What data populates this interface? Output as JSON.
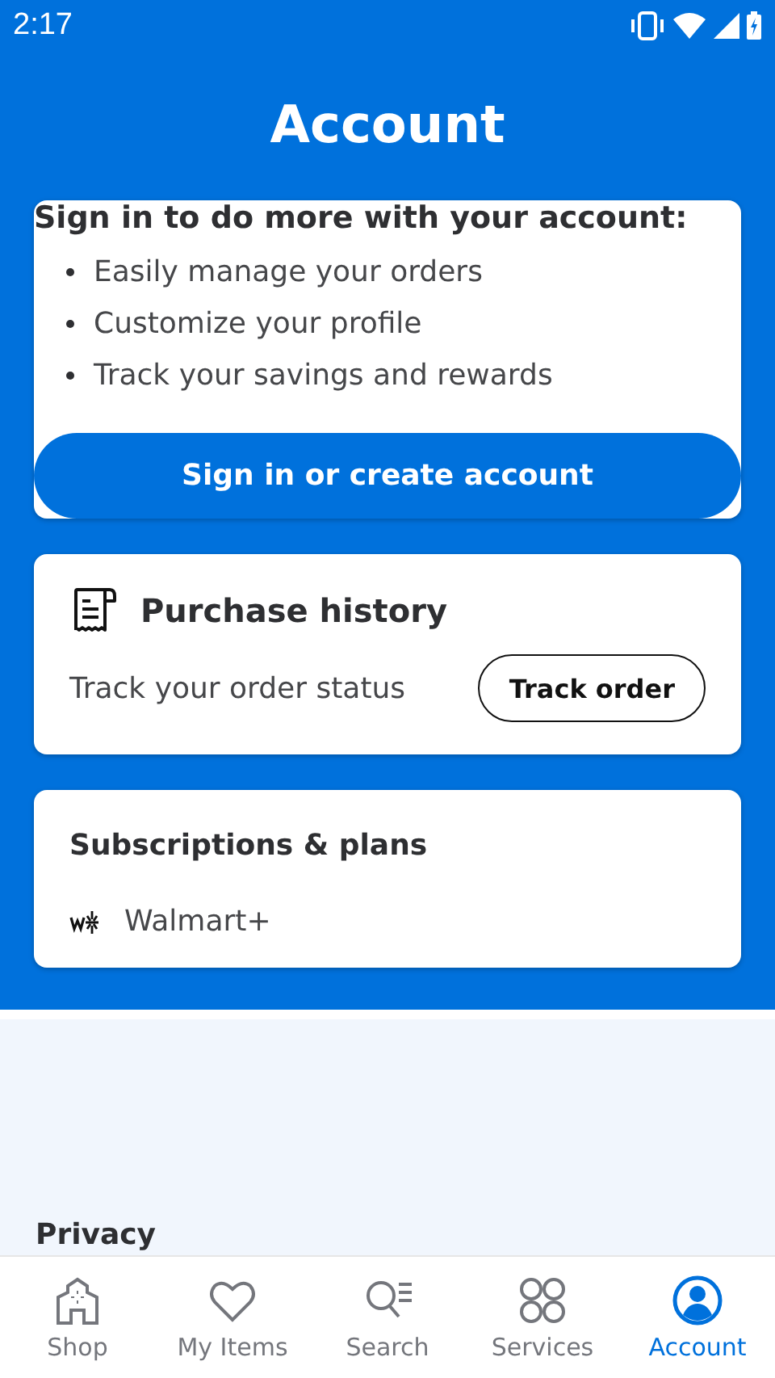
{
  "status_bar": {
    "time": "2:17"
  },
  "title": "Account",
  "sign_in_card": {
    "heading": "Sign in to do more with your account:",
    "bullets": [
      "Easily manage your orders",
      "Customize your profile",
      "Track your savings and rewards"
    ],
    "button": "Sign in or create account"
  },
  "purchase_card": {
    "heading": "Purchase history",
    "text": "Track your order status",
    "button": "Track order"
  },
  "subscriptions_card": {
    "heading": "Subscriptions & plans",
    "item": "Walmart+"
  },
  "section_heading": "Privacy",
  "nav": [
    {
      "label": "Shop",
      "kind": "shop",
      "selected": false
    },
    {
      "label": "My Items",
      "kind": "heart",
      "selected": false
    },
    {
      "label": "Search",
      "kind": "search",
      "selected": false
    },
    {
      "label": "Services",
      "kind": "services",
      "selected": false
    },
    {
      "label": "Account",
      "kind": "account",
      "selected": true
    }
  ]
}
